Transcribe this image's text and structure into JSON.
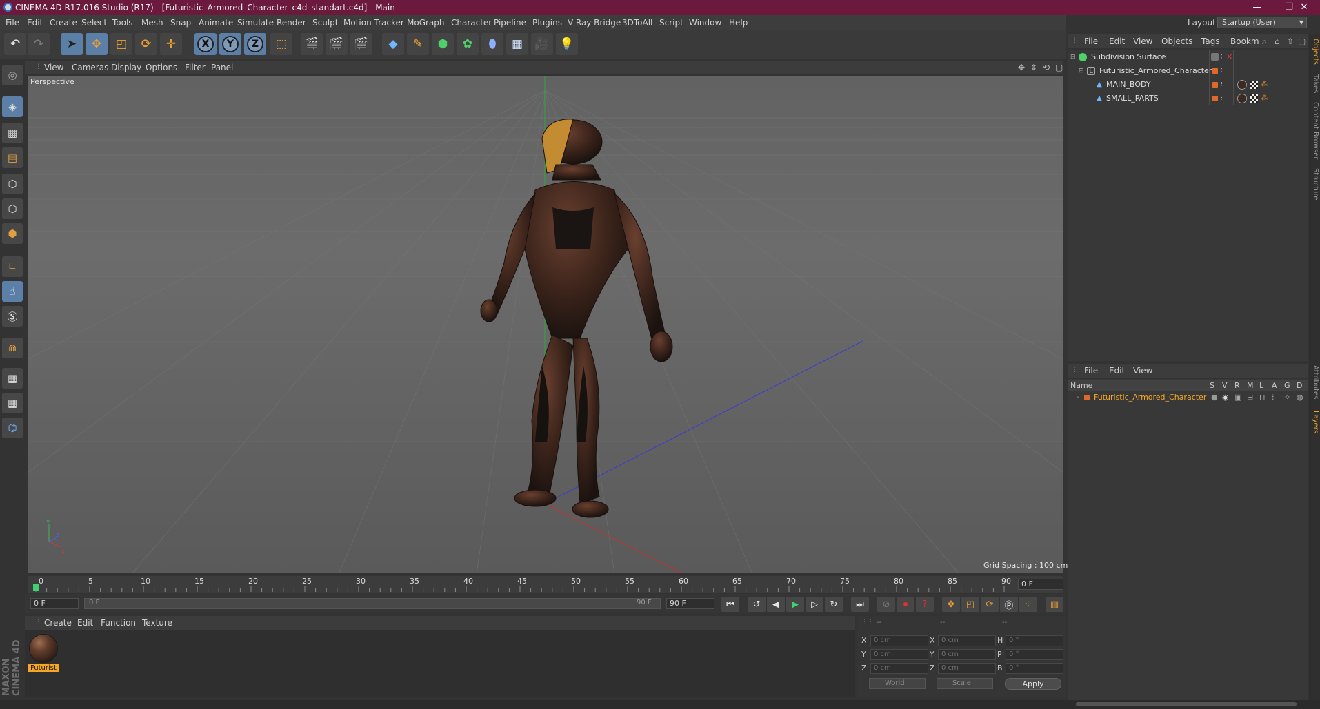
{
  "window": {
    "title": "CINEMA 4D R17.016 Studio (R17) - [Futuristic_Armored_Character_c4d_standart.c4d] - Main",
    "controls": [
      "—",
      "❐",
      "✕"
    ]
  },
  "menu": [
    "File",
    "Edit",
    "Create",
    "Select",
    "Tools",
    "Mesh",
    "Snap",
    "Animate",
    "Simulate",
    "Render",
    "Sculpt",
    "Motion Tracker",
    "MoGraph",
    "Character",
    "Pipeline",
    "Plugins",
    "V-Ray Bridge",
    "3DToAll",
    "Script",
    "Window",
    "Help"
  ],
  "layout": {
    "label": "Layout:",
    "value": "Startup (User)"
  },
  "toolbar": {
    "axis_x": "X",
    "axis_y": "Y",
    "axis_z": "Z"
  },
  "viewport": {
    "menu": [
      "View",
      "Cameras",
      "Display",
      "Options",
      "Filter",
      "Panel"
    ],
    "camera_label": "Perspective",
    "grid_spacing": "Grid Spacing : 100 cm"
  },
  "timeline": {
    "ticks": [
      "0",
      "5",
      "10",
      "15",
      "20",
      "25",
      "30",
      "35",
      "40",
      "45",
      "50",
      "55",
      "60",
      "65",
      "70",
      "75",
      "80",
      "85",
      "90"
    ],
    "end_frame_display": "0 F",
    "current_frame": "0 F",
    "range_start": "0 F",
    "range_end": "90 F",
    "max_frame": "90 F"
  },
  "material_manager": {
    "menu": [
      "Create",
      "Edit",
      "Function",
      "Texture"
    ],
    "materials": [
      {
        "label": "Futurist"
      }
    ]
  },
  "coordinates": {
    "headers": [
      "--",
      "--",
      "--"
    ],
    "rows": [
      {
        "axis": "X",
        "pos": "0 cm",
        "size_axis": "X",
        "size": "0 cm",
        "rot_axis": "H",
        "rot": "0 °"
      },
      {
        "axis": "Y",
        "pos": "0 cm",
        "size_axis": "Y",
        "size": "0 cm",
        "rot_axis": "P",
        "rot": "0 °"
      },
      {
        "axis": "Z",
        "pos": "0 cm",
        "size_axis": "Z",
        "size": "0 cm",
        "rot_axis": "B",
        "rot": "0 °"
      }
    ],
    "mode_world": "World",
    "mode_scale": "Scale",
    "apply": "Apply"
  },
  "object_manager": {
    "menu": [
      "File",
      "Edit",
      "View",
      "Objects",
      "Tags",
      "Bookm"
    ],
    "objects": [
      {
        "name": "Subdivision Surface"
      },
      {
        "name": "Futuristic_Armored_Character"
      },
      {
        "name": "MAIN_BODY"
      },
      {
        "name": "SMALL_PARTS"
      }
    ]
  },
  "layer_manager": {
    "menu": [
      "File",
      "Edit",
      "View"
    ],
    "columns": [
      "Name",
      "S",
      "V",
      "R",
      "M",
      "L",
      "A",
      "G",
      "D"
    ],
    "layers": [
      {
        "name": "Futuristic_Armored_Character"
      }
    ]
  },
  "right_tabs": [
    "Objects",
    "Takes",
    "Content Browser",
    "Structure",
    "Attributes",
    "Layers"
  ],
  "brand": "MAXON CINEMA 4D",
  "colors": {
    "accent": "#f5a623",
    "title_bar": "#6b1a3d",
    "layer_orange": "#e0692a"
  }
}
